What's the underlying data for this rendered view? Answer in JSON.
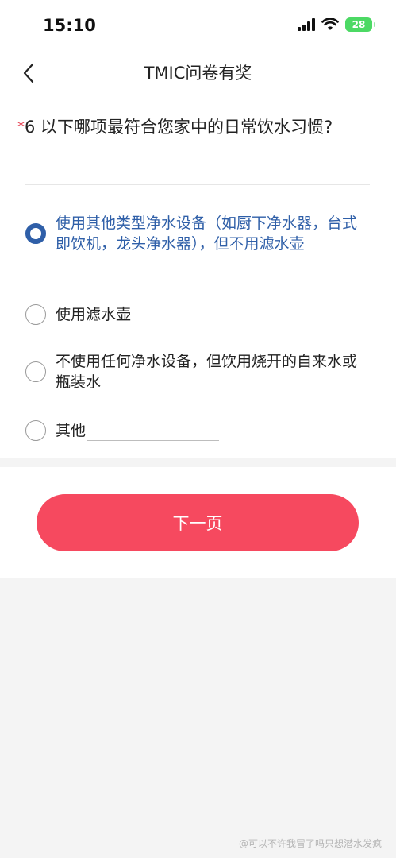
{
  "status_bar": {
    "time": "15:10",
    "battery": "28"
  },
  "header": {
    "title": "TMIC问卷有奖"
  },
  "question": {
    "required_mark": "*",
    "text": "6 以下哪项最符合您家中的日常饮水习惯?"
  },
  "options": [
    {
      "label": "使用其他类型净水设备（如厨下净水器，台式即饮机，龙头净水器），但不用滤水壶",
      "selected": true
    },
    {
      "label": "使用滤水壶",
      "selected": false
    },
    {
      "label": "不使用任何净水设备，但饮用烧开的自来水或瓶装水",
      "selected": false
    },
    {
      "label": "其他",
      "selected": false
    }
  ],
  "other_input": {
    "value": ""
  },
  "footer": {
    "next_label": "下一页"
  },
  "watermark": "@可以不许我冒了吗只想潜水发疯",
  "colors": {
    "accent": "#f6495f",
    "selected": "#2f5fa8",
    "required": "#e53e4f",
    "battery": "#4cd964"
  }
}
